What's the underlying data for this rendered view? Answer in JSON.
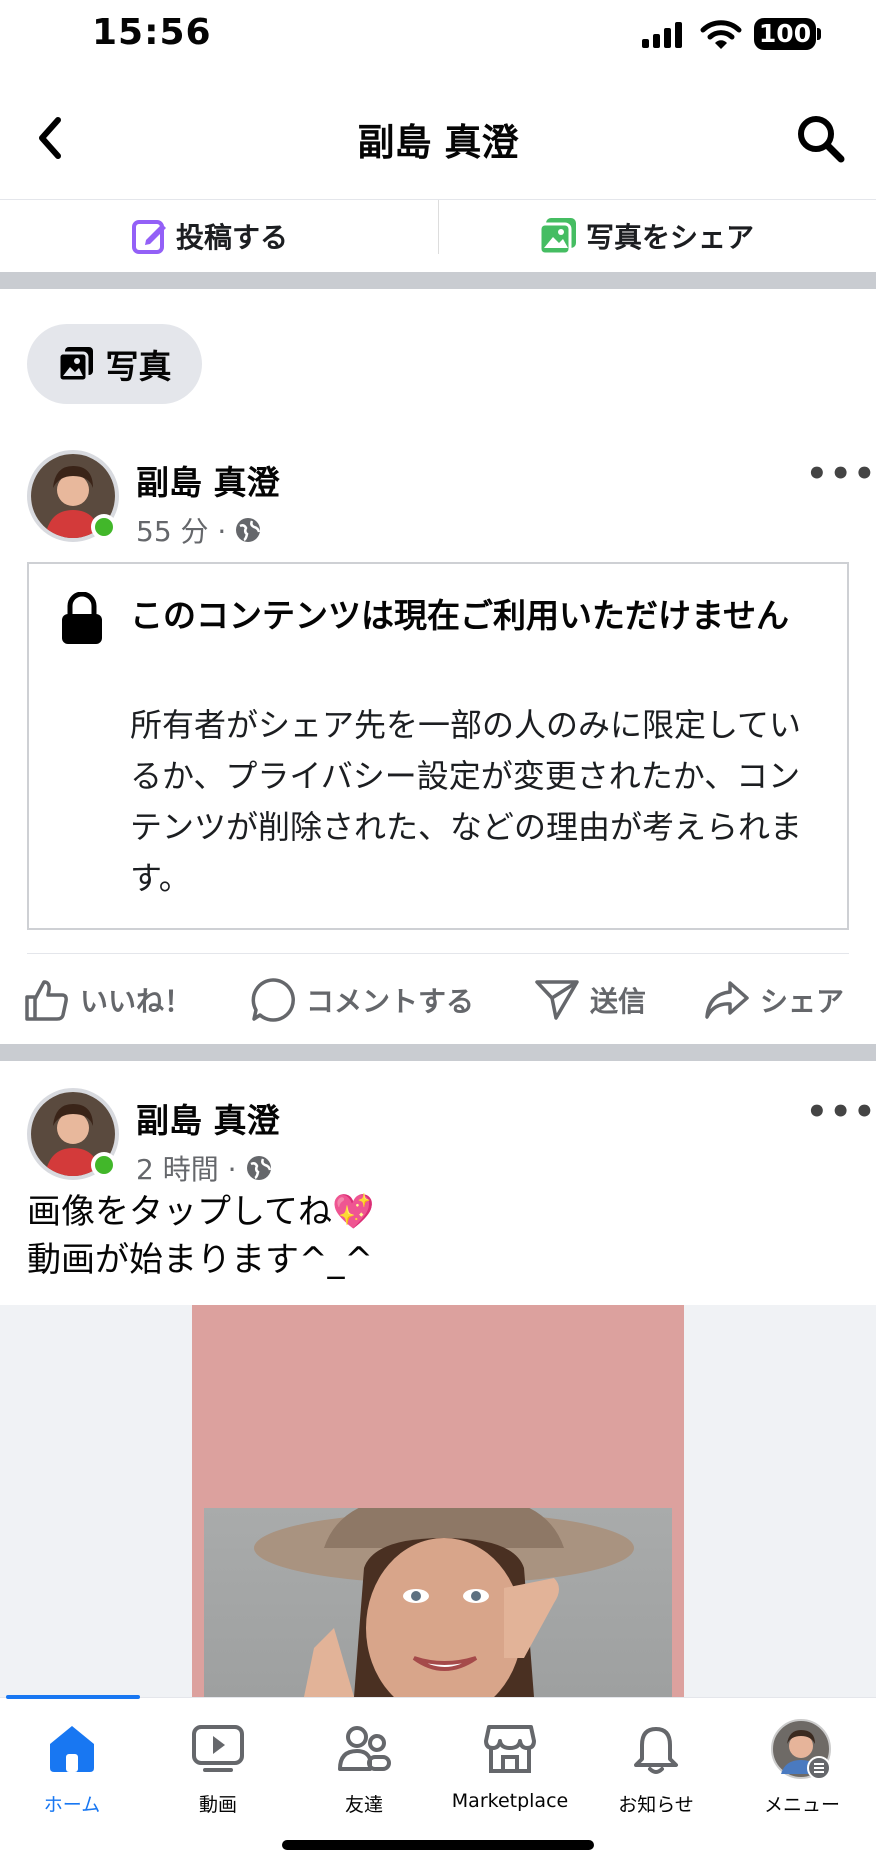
{
  "status": {
    "time": "15:56",
    "battery": "100"
  },
  "header": {
    "title": "副島 真澄"
  },
  "actions": {
    "post": "投稿する",
    "share_photo": "写真をシェア"
  },
  "chip": {
    "label": "写真"
  },
  "post1": {
    "author": "副島 真澄",
    "time": "55 分 ·",
    "unavailable_title": "このコンテンツは現在ご利用いただけません",
    "unavailable_body": "所有者がシェア先を一部の人のみに限定しているか、プライバシー設定が変更されたか、コンテンツが削除された、などの理由が考えられます。"
  },
  "reactions": {
    "like": "いいね！",
    "comment": "コメントする",
    "send": "送信",
    "share": "シェア"
  },
  "post2": {
    "author": "副島 真澄",
    "time": "2 時間 ·",
    "caption_line1": "画像をタップしてね💖",
    "caption_line2": "動画が始まります^_^"
  },
  "tabs": [
    {
      "label": "ホーム",
      "icon": "home-icon",
      "active": true
    },
    {
      "label": "動画",
      "icon": "video-icon"
    },
    {
      "label": "友達",
      "icon": "friends-icon"
    },
    {
      "label": "Marketplace",
      "icon": "marketplace-icon"
    },
    {
      "label": "お知らせ",
      "icon": "bell-icon"
    },
    {
      "label": "メニュー",
      "icon": "menu-avatar"
    }
  ],
  "colors": {
    "accent": "#1877f2",
    "online": "#42b72a",
    "separator": "#c9ccd1",
    "media_bg": "#dca19e"
  }
}
